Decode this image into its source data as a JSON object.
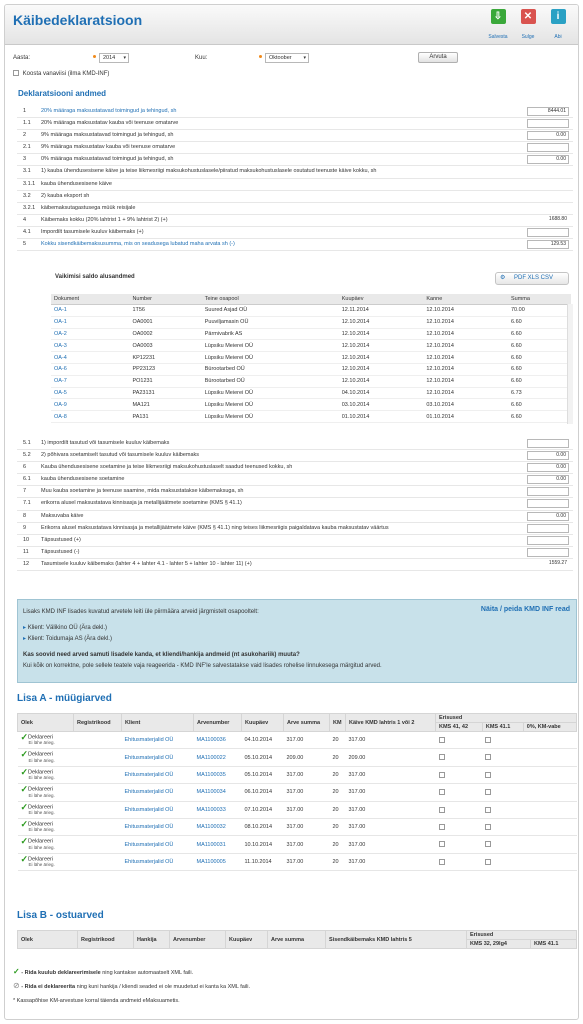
{
  "header": {
    "title": "Käibedeklaratsioon",
    "save_label": "Salvesta",
    "close_label": "Sulge",
    "help_label": "Abi"
  },
  "form": {
    "year_label": "Aasta:",
    "year_value": "2014",
    "month_label": "Kuu:",
    "month_value": "Oktoober",
    "calc_label": "Arvuta",
    "no_kmd_label": "Koosta vanaviisi (ilma KMD-INF)"
  },
  "decl": {
    "title": "Deklaratsiooni andmed",
    "rows": [
      {
        "code": "1",
        "text": "20% määraga maksustatavad toimingud ja tehingud, sh",
        "value": "8444.01",
        "blue": true,
        "box": true
      },
      {
        "code": "1.1",
        "text": "20% määraga maksustatav kauba või teenuse omatarve",
        "value": "",
        "box": true
      },
      {
        "code": "2",
        "text": "9% määraga maksustatavad toimingud ja tehingud, sh",
        "value": "0.00",
        "box": true
      },
      {
        "code": "2.1",
        "text": "9% määraga maksustatav kauba või teenuse omatarve",
        "value": "",
        "box": true
      },
      {
        "code": "3",
        "text": "0% määraga maksustatavad toimingud ja tehingud, sh",
        "value": "0.00",
        "box": true
      },
      {
        "code": "3.1",
        "text": "1) kauba ühendusesisene käive ja teise liikmesriigi maksukohustuslasele/piiratud maksukohustuslasele osutatud teenuste käive kokku, sh",
        "value": "",
        "box": false
      },
      {
        "code": "3.1.1",
        "text": "kauba ühendusesisene käive",
        "value": "",
        "box": false
      },
      {
        "code": "3.2",
        "text": "2) kauba eksport sh",
        "value": "",
        "box": false
      },
      {
        "code": "3.2.1",
        "text": "käibemaksutagastusega müük reisijale",
        "value": "",
        "box": false
      },
      {
        "code": "4",
        "text": "Käibemaks kokku (20% lahtrist 1 + 9% lahtrist 2) (+)",
        "value": "1688.80",
        "box": false
      },
      {
        "code": "4.1",
        "text": "Impordilt tasumisele kuuluv käibemaks (+)",
        "value": "",
        "box": true
      },
      {
        "code": "5",
        "text": "Kokku sisendkäibemaksusumma, mis on seadusega lubatud maha arvata sh (-)",
        "value": "129.53",
        "blue": true,
        "box": true
      }
    ],
    "rows2": [
      {
        "code": "5.1",
        "text": "1) impordilt tasutud või tasumisele kuuluv käibemaks",
        "value": "",
        "box": true
      },
      {
        "code": "5.2",
        "text": "2) põhivara soetamiselt tasutud või tasumisele kuuluv käibemaks",
        "value": "0.00",
        "box": true
      },
      {
        "code": "6",
        "text": "Kauba ühendusesisene soetamine ja teise liikmesriigi maksukohustuslaselt saadud teenused kokku, sh",
        "value": "0.00",
        "box": true
      },
      {
        "code": "6.1",
        "text": "kauba ühendusesisene soetamine",
        "value": "0.00",
        "box": true
      },
      {
        "code": "7",
        "text": "Muu kauba soetamine ja teenuse saamine, mida maksustatakse käibemaksuga, sh",
        "value": "",
        "box": true
      },
      {
        "code": "7.1",
        "text": "erikorra alusel maksustatava kinnisasja ja metallijäätmete soetamine (KMS § 41.1)",
        "value": "",
        "box": true
      },
      {
        "code": "8",
        "text": "Maksuvaba käive",
        "value": "0.00",
        "box": true
      },
      {
        "code": "9",
        "text": "Erikorra alusel maksustatava kinnisasja ja metallijäätmete käive (KMS § 41.1) ning teises liikmesriigis paigaldatava kauba maksustatav väärtus",
        "value": "",
        "box": true
      },
      {
        "code": "10",
        "text": "Täpsustused (+)",
        "value": "",
        "box": true
      },
      {
        "code": "11",
        "text": "Täpsustused (-)",
        "value": "",
        "box": true
      },
      {
        "code": "12",
        "text": "Tasumisele kuuluv käibemaks (lahter 4 + lahter 4.1 - lahter 5 + lahter 10 - lahter 11) (+)",
        "value": "1559.27",
        "box": false
      }
    ]
  },
  "saldo": {
    "title": "Vaikimisi saldo alusandmed",
    "export_label": "PDF  XLS  CSV",
    "headers": [
      "Dokument",
      "Number",
      "Teine osapool",
      "Kuupäev",
      "Kanne",
      "Summa"
    ],
    "rows": [
      [
        "OA-1",
        "1T56",
        "Suured Asjad OÜ",
        "12.11.2014",
        "12.10.2014",
        "70.00"
      ],
      [
        "OA-1",
        "OA0001",
        "Puuviljamasin OÜ",
        "12.10.2014",
        "12.10.2014",
        "6.60"
      ],
      [
        "OA-2",
        "OA0002",
        "Pärmivabrik AS",
        "12.10.2014",
        "12.10.2014",
        "6.60"
      ],
      [
        "OA-3",
        "OA0003",
        "Lüpsiku Meierei OÜ",
        "12.10.2014",
        "12.10.2014",
        "6.60"
      ],
      [
        "OA-4",
        "KP12231",
        "Lüpsiku Meierei OÜ",
        "12.10.2014",
        "12.10.2014",
        "6.60"
      ],
      [
        "OA-6",
        "PP23123",
        "Bürootarbed OÜ",
        "12.10.2014",
        "12.10.2014",
        "6.60"
      ],
      [
        "OA-7",
        "PO1231",
        "Bürootarbed OÜ",
        "12.10.2014",
        "12.10.2014",
        "6.60"
      ],
      [
        "OA-5",
        "PA23131",
        "Lüpsiku Meierei OÜ",
        "04.10.2014",
        "12.10.2014",
        "6.73"
      ],
      [
        "OA-9",
        "MA121",
        "Lüpsiku Meierei OÜ",
        "03.10.2014",
        "03.10.2014",
        "6.60"
      ],
      [
        "OA-8",
        "PA131",
        "Lüpsiku Meierei OÜ",
        "01.10.2014",
        "01.10.2014",
        "6.60"
      ]
    ]
  },
  "info": {
    "intro": "Lisaks KMD INF lisades kuvatud arvetele leiti üle piirmäära arveid järgmistelt osapooltelt:",
    "link": "Näita / peida KMD INF read",
    "client1": "Klient: Välikino OÜ (Ära dekl.)",
    "client2": "Klient: Toidumaja AS (Ära dekl.)",
    "question": "Kas soovid need arved samuti lisadele kanda, et kliendi/hankija andmeid (nt asukohariik) muuta?",
    "note": "Kui kõik on korrektne, pole sellele teatele vaja reageerida - KMD INF'le salvestatakse vaid lisades rohelise linnukesega märgitud arved."
  },
  "lisa_a": {
    "title": "Lisa A - müügiarved",
    "headers": [
      "Olek",
      "Registrikood",
      "Klient",
      "Arvenumber",
      "Kuupäev",
      "Arve summa",
      "KM",
      "Käive KMD lahtris 1 või 2",
      "Erisused",
      "KMS 41, 42",
      "KMS 41.1",
      "0%, KM-vabe"
    ],
    "status_label": "Deklareeri",
    "status_sub": "Ei lähe ärieg.",
    "rows": [
      [
        "Ehitusmaterjalid OÜ",
        "MA1100036",
        "04.10.2014",
        "317.00",
        "20",
        "317.00"
      ],
      [
        "Ehitusmaterjalid OÜ",
        "MA1100022",
        "05.10.2014",
        "209.00",
        "20",
        "209.00"
      ],
      [
        "Ehitusmaterjalid OÜ",
        "MA1100035",
        "05.10.2014",
        "317.00",
        "20",
        "317.00"
      ],
      [
        "Ehitusmaterjalid OÜ",
        "MA1100034",
        "06.10.2014",
        "317.00",
        "20",
        "317.00"
      ],
      [
        "Ehitusmaterjalid OÜ",
        "MA1100033",
        "07.10.2014",
        "317.00",
        "20",
        "317.00"
      ],
      [
        "Ehitusmaterjalid OÜ",
        "MA1100032",
        "08.10.2014",
        "317.00",
        "20",
        "317.00"
      ],
      [
        "Ehitusmaterjalid OÜ",
        "MA1100031",
        "10.10.2014",
        "317.00",
        "20",
        "317.00"
      ],
      [
        "Ehitusmaterjalid OÜ",
        "MA1100005",
        "11.10.2014",
        "317.00",
        "20",
        "317.00"
      ]
    ]
  },
  "lisa_b": {
    "title": "Lisa B - ostuarved",
    "headers": [
      "Olek",
      "Registrikood",
      "Hankija",
      "Arvenumber",
      "Kuupäev",
      "Arve summa",
      "Sisendkäibemaks KMD lahtris 5",
      "Erisused",
      "KMS 32, 29lg4",
      "KMS 41.1"
    ]
  },
  "legend": {
    "ok_bold": "- Rida kuulub deklareerimisele",
    "ok_rest": " ning kantakse automaatselt XML faili.",
    "no_bold": "- Rida ei deklareerita",
    "no_rest": " ning kuni hankija / kliendi seaded ei ole muudetud ei kanta ka XML faili.",
    "footnote": "* Kassapõhise KM-arvestuse korral täienda andmeid eMaksuametis."
  }
}
